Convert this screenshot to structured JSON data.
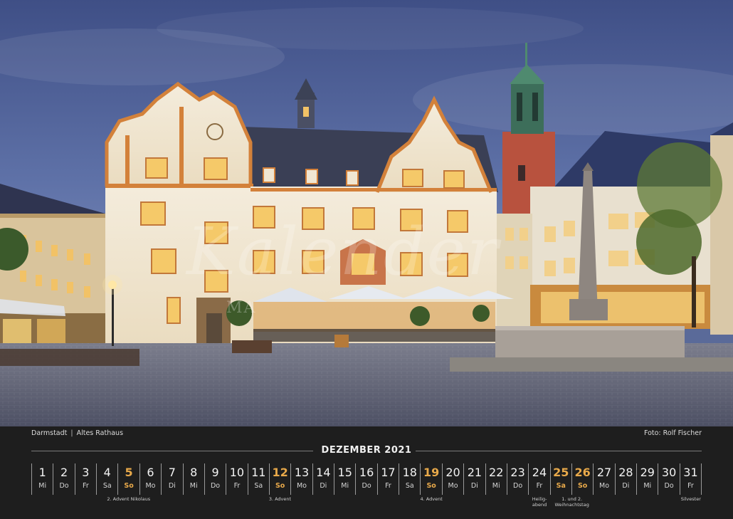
{
  "photo": {
    "caption_city": "Darmstadt",
    "caption_separator": "|",
    "caption_place": "Altes Rathaus",
    "credit": "Foto: Rolf Fischer",
    "watermark_script": "Kalender",
    "watermark_brand": "MA",
    "colors": {
      "sky": "#4f5f95",
      "facade": "#f0e6d2",
      "trim": "#d3813a",
      "roof": "#3a3f55",
      "tower": "#b8523e",
      "pavement": "#6a6e80"
    }
  },
  "calendar": {
    "month_title": "DEZEMBER 2021",
    "accent_color": "#e8a94a",
    "days": [
      {
        "num": "1",
        "wd": "Mi",
        "type": "normal"
      },
      {
        "num": "2",
        "wd": "Do",
        "type": "normal"
      },
      {
        "num": "3",
        "wd": "Fr",
        "type": "normal"
      },
      {
        "num": "4",
        "wd": "Sa",
        "type": "normal"
      },
      {
        "num": "5",
        "wd": "So",
        "type": "sun"
      },
      {
        "num": "6",
        "wd": "Mo",
        "type": "normal"
      },
      {
        "num": "7",
        "wd": "Di",
        "type": "normal"
      },
      {
        "num": "8",
        "wd": "Mi",
        "type": "normal"
      },
      {
        "num": "9",
        "wd": "Do",
        "type": "normal"
      },
      {
        "num": "10",
        "wd": "Fr",
        "type": "normal"
      },
      {
        "num": "11",
        "wd": "Sa",
        "type": "normal"
      },
      {
        "num": "12",
        "wd": "So",
        "type": "sun"
      },
      {
        "num": "13",
        "wd": "Mo",
        "type": "normal"
      },
      {
        "num": "14",
        "wd": "Di",
        "type": "normal"
      },
      {
        "num": "15",
        "wd": "Mi",
        "type": "normal"
      },
      {
        "num": "16",
        "wd": "Do",
        "type": "normal"
      },
      {
        "num": "17",
        "wd": "Fr",
        "type": "normal"
      },
      {
        "num": "18",
        "wd": "Sa",
        "type": "normal"
      },
      {
        "num": "19",
        "wd": "So",
        "type": "sun"
      },
      {
        "num": "20",
        "wd": "Mo",
        "type": "normal"
      },
      {
        "num": "21",
        "wd": "Di",
        "type": "normal"
      },
      {
        "num": "22",
        "wd": "Mi",
        "type": "normal"
      },
      {
        "num": "23",
        "wd": "Do",
        "type": "normal"
      },
      {
        "num": "24",
        "wd": "Fr",
        "type": "normal"
      },
      {
        "num": "25",
        "wd": "Sa",
        "type": "hol"
      },
      {
        "num": "26",
        "wd": "So",
        "type": "sun"
      },
      {
        "num": "27",
        "wd": "Mo",
        "type": "normal"
      },
      {
        "num": "28",
        "wd": "Di",
        "type": "normal"
      },
      {
        "num": "29",
        "wd": "Mi",
        "type": "normal"
      },
      {
        "num": "30",
        "wd": "Do",
        "type": "normal"
      },
      {
        "num": "31",
        "wd": "Fr",
        "type": "normal"
      }
    ],
    "notes": [
      {
        "day": 5,
        "lines": [
          "2. Advent Nikolaus"
        ]
      },
      {
        "day": 12,
        "lines": [
          "3. Advent"
        ]
      },
      {
        "day": 19,
        "lines": [
          "4. Advent"
        ]
      },
      {
        "day": 24,
        "lines": [
          "Heilig-",
          "abend"
        ]
      },
      {
        "day": 25.5,
        "lines": [
          "1. und 2.",
          "Weihnachtstag"
        ]
      },
      {
        "day": 31,
        "lines": [
          "Silvester"
        ]
      }
    ]
  }
}
